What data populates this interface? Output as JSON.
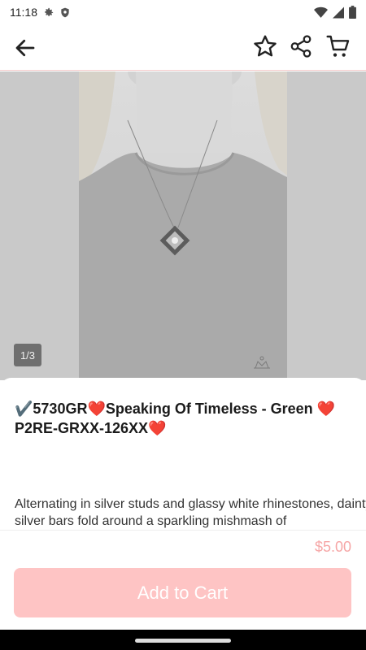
{
  "status_bar": {
    "time": "11:18",
    "icons": [
      "gear-icon",
      "shield-icon",
      "wifi-icon",
      "signal-icon",
      "battery-icon"
    ]
  },
  "toolbar": {
    "icons": [
      "back-arrow-icon",
      "star-icon",
      "share-icon",
      "cart-icon"
    ]
  },
  "gallery": {
    "counter": "1/3"
  },
  "product": {
    "title": "✔️5730GR❤️Speaking Of Timeless - Green ❤️P2RE-GRXX-126XX❤️",
    "description": "Alternating in silver studs and glassy white rhinestones, dainty silver bars fold around a sparkling mishmash of",
    "price": "$5.00"
  },
  "cart": {
    "add_label": "Add to Cart"
  },
  "colors": {
    "accent": "#fec4c4",
    "price": "#f6a6a6"
  }
}
